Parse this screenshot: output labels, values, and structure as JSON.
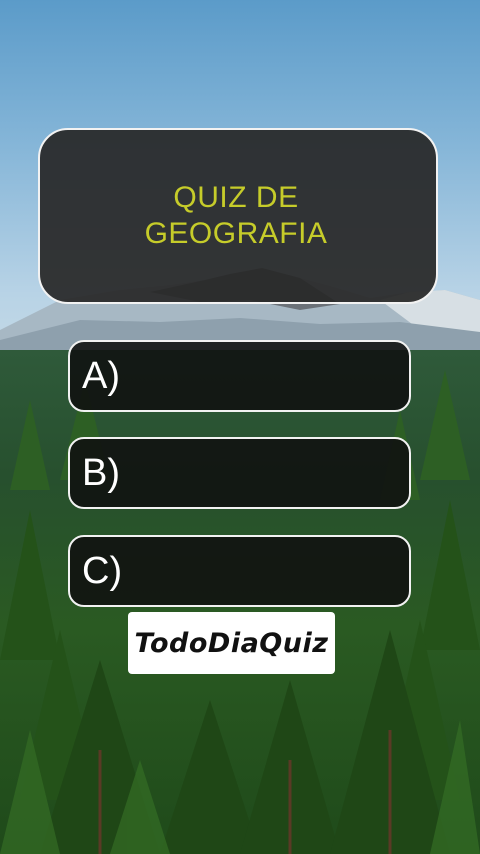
{
  "quiz": {
    "title": "QUIZ DE\nGEOGRAFIA",
    "options": [
      {
        "label": "A)"
      },
      {
        "label": "B)"
      },
      {
        "label": "C)"
      }
    ]
  },
  "brand": {
    "name": "TodoDiaQuiz"
  },
  "colors": {
    "title_text": "#c6cc2a",
    "card_border": "#f2f2f2",
    "card_background": "#282828"
  }
}
